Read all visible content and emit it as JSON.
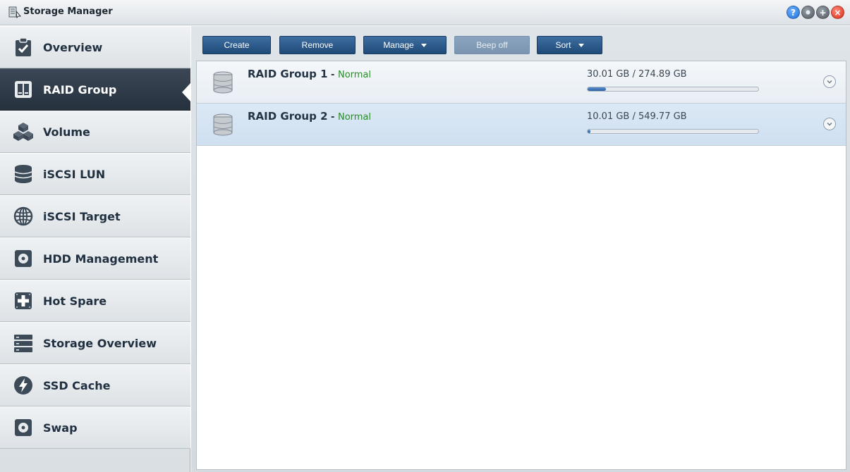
{
  "window": {
    "title": "Storage Manager",
    "controls": [
      "help-icon",
      "minimize-icon",
      "maximize-icon",
      "close-icon"
    ]
  },
  "sidebar": {
    "items": [
      {
        "label": "Overview",
        "icon": "clipboard-check-icon",
        "active": false
      },
      {
        "label": "RAID Group",
        "icon": "raid-group-icon",
        "active": true
      },
      {
        "label": "Volume",
        "icon": "volume-cubes-icon",
        "active": false
      },
      {
        "label": "iSCSI LUN",
        "icon": "database-icon",
        "active": false
      },
      {
        "label": "iSCSI Target",
        "icon": "globe-icon",
        "active": false
      },
      {
        "label": "HDD Management",
        "icon": "hdd-icon",
        "active": false
      },
      {
        "label": "Hot Spare",
        "icon": "hot-spare-plus-icon",
        "active": false
      },
      {
        "label": "Storage Overview",
        "icon": "server-rack-icon",
        "active": false
      },
      {
        "label": "SSD Cache",
        "icon": "lightning-icon",
        "active": false
      },
      {
        "label": "Swap",
        "icon": "swap-disk-icon",
        "active": false
      }
    ]
  },
  "toolbar": {
    "create_label": "Create",
    "remove_label": "Remove",
    "manage_label": "Manage",
    "beep_off_label": "Beep off",
    "sort_label": "Sort"
  },
  "raid_groups": [
    {
      "name": "RAID Group 1",
      "separator": " - ",
      "status": "Normal",
      "usage": "30.01 GB / 274.89 GB",
      "used_fraction": 0.109,
      "selected": false
    },
    {
      "name": "RAID Group 2",
      "separator": " - ",
      "status": "Normal",
      "usage": "10.01 GB / 549.77 GB",
      "used_fraction": 0.018,
      "selected": true
    }
  ],
  "colors": {
    "status_normal": "#2b8a2b",
    "button_blue": "#2a5686",
    "sidebar_active": "#2f3a48"
  }
}
